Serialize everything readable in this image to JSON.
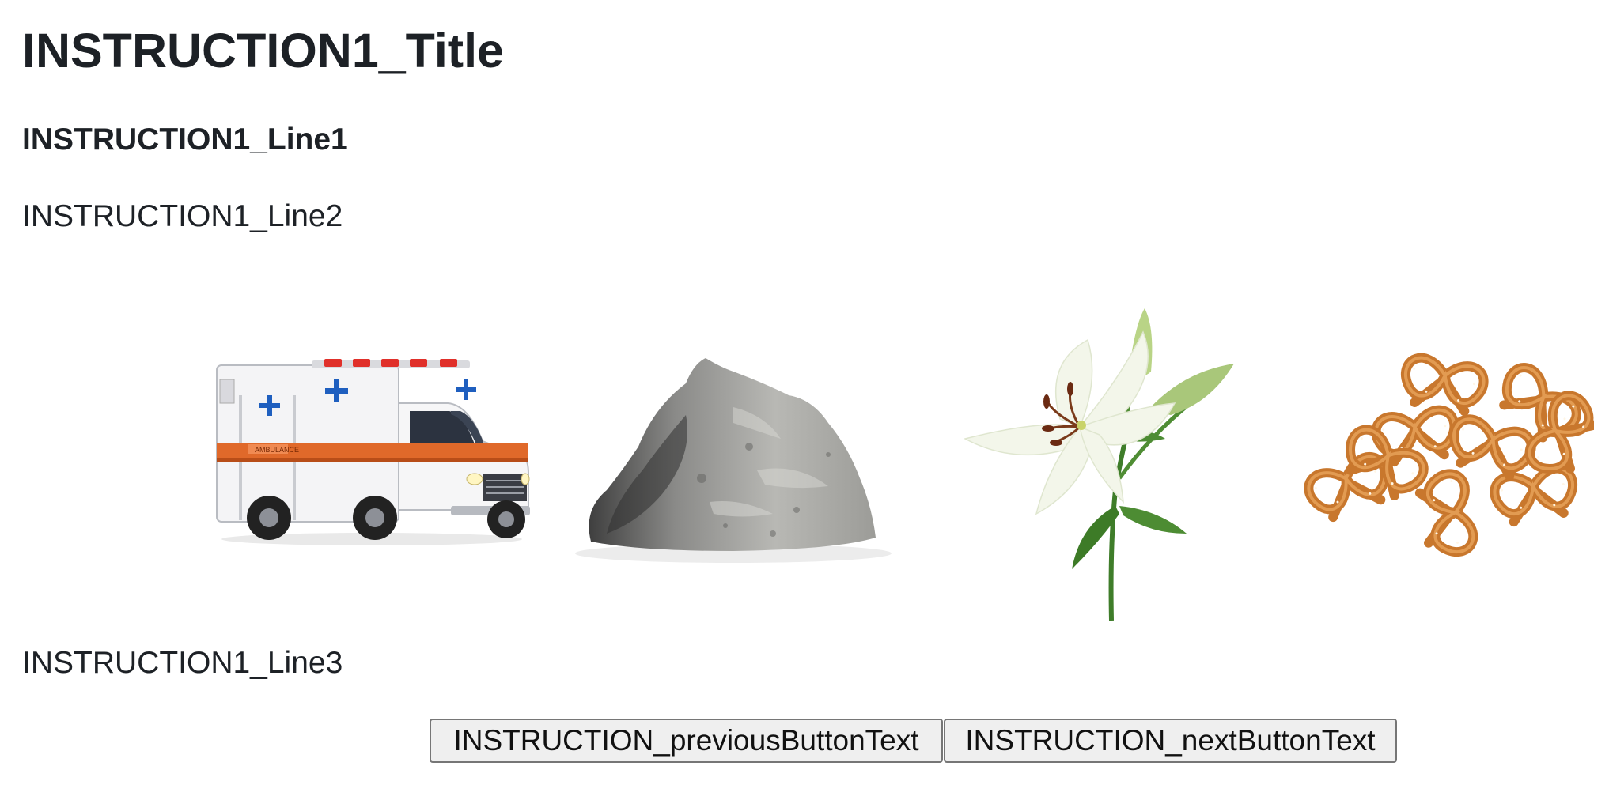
{
  "instruction": {
    "title": "INSTRUCTION1_Title",
    "line1": "INSTRUCTION1_Line1",
    "line2": "INSTRUCTION1_Line2",
    "line3": "INSTRUCTION1_Line3"
  },
  "stimuli": [
    {
      "name": "ambulance",
      "kind": "photo"
    },
    {
      "name": "rock",
      "kind": "photo"
    },
    {
      "name": "lily",
      "kind": "photo"
    },
    {
      "name": "pretzels",
      "kind": "photo"
    }
  ],
  "buttons": {
    "previous": "INSTRUCTION_previousButtonText",
    "next": "INSTRUCTION_nextButtonText"
  },
  "colors": {
    "text": "#1d2126",
    "button_bg": "#efefef",
    "button_border": "#767676",
    "ambulance_stripe": "#e0692a",
    "pretzel": "#c8772d"
  }
}
